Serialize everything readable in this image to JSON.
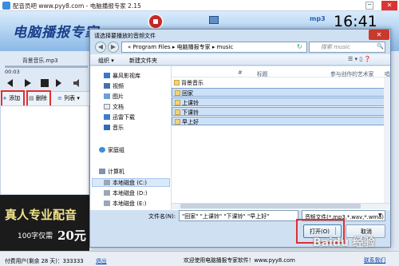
{
  "app": {
    "title": "配音员吧 www.pyy8.com - 电脑播报专家 2.15",
    "logo_text": "电脑播报专家",
    "clock": "16:41",
    "mp3_label": "mp3",
    "minimize": "─",
    "close": "✕"
  },
  "player": {
    "filename": "背景音乐.mp3",
    "time": "00:03"
  },
  "toolbar": {
    "add": "添加",
    "delete": "删除",
    "list": "列表"
  },
  "ad": {
    "line1": "真人专业配音",
    "line2": "100字仅需",
    "price": "20元"
  },
  "status": {
    "user": "付费用户(剩余 28 天)：333333",
    "exit": "退出",
    "welcome": "欢迎使用电脑播报专家软件！www.pyy8.com",
    "contact": "联系我们"
  },
  "dialog": {
    "title": "请选择要播放的音频文件",
    "close": "✕",
    "back": "◀",
    "forward": "▶",
    "address": "« Program Files ▸ 电脑播报专家 ▸ music",
    "refresh": "↻",
    "search_placeholder": "搜索 music",
    "search_icon": "🔍",
    "organize": "组织 ▾",
    "new_folder": "新建文件夹",
    "view_icons": "☰ ▾  ▯  ❓",
    "nav": [
      {
        "label": "暴风影视库"
      },
      {
        "label": "视频"
      },
      {
        "label": "图片"
      },
      {
        "label": "文档"
      },
      {
        "label": "迅雷下载"
      },
      {
        "label": "音乐"
      },
      {
        "label": "家庭组"
      },
      {
        "label": "计算机"
      },
      {
        "label": "本地磁盘 (C:)"
      },
      {
        "label": "本地磁盘 (D:)"
      },
      {
        "label": "本地磁盘 (E:)"
      },
      {
        "label": "本地磁盘 (F:)"
      }
    ],
    "columns": {
      "num": "#",
      "title": "标题",
      "artist": "参与创作的艺术家",
      "album": "唱"
    },
    "files": [
      {
        "name": "背景音乐",
        "selected": false
      },
      {
        "name": "回家",
        "selected": true
      },
      {
        "name": "上课铃",
        "selected": true
      },
      {
        "name": "下课铃",
        "selected": true
      },
      {
        "name": "早上好",
        "selected": true
      }
    ],
    "filename_label": "文件名(N):",
    "filename_value": "\"回家\" \"上课铃\" \"下课铃\" \"早上好\"",
    "filter_value": "音频文件(*.mp3,*.wav,*.wma)",
    "filter_arrow": "▼",
    "open": "打开(O)",
    "cancel": "取消",
    "watermark": "Baidu 经验"
  },
  "colors": {
    "highlight_red": "#e03030",
    "selection_blue": "#cce0f8",
    "dialog_frame": "#cfe0f3"
  }
}
